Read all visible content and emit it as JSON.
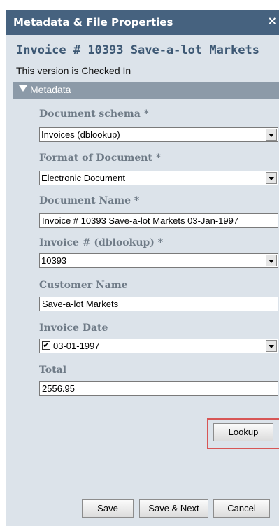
{
  "panel": {
    "title": "Metadata & File Properties",
    "close_glyph": "×",
    "document_title": "Invoice # 10393 Save-a-lot Markets",
    "status": "This version is Checked In"
  },
  "section": {
    "label": "Metadata",
    "expanded": true
  },
  "fields": {
    "document_schema": {
      "label": "Document schema *",
      "value": "Invoices (dblookup)"
    },
    "format_of_document": {
      "label": "Format of Document *",
      "value": "Electronic Document"
    },
    "document_name": {
      "label": "Document Name *",
      "value": "Invoice # 10393 Save-a-lot Markets 03-Jan-1997"
    },
    "invoice_number": {
      "label": "Invoice # (dblookup) *",
      "value": "10393"
    },
    "customer_name": {
      "label": "Customer Name",
      "value": "Save-a-lot Markets"
    },
    "invoice_date": {
      "label": "Invoice Date",
      "value": "03-01-1997",
      "checked": true,
      "check_glyph": "✔"
    },
    "total": {
      "label": "Total",
      "value": "2556.95"
    }
  },
  "buttons": {
    "lookup": "Lookup",
    "save": "Save",
    "save_next": "Save & Next",
    "cancel": "Cancel"
  },
  "colors": {
    "titlebar": "#46627f",
    "panel_bg": "#dce3ea",
    "section_bar": "#8c9aa8",
    "highlight": "#d75656"
  }
}
